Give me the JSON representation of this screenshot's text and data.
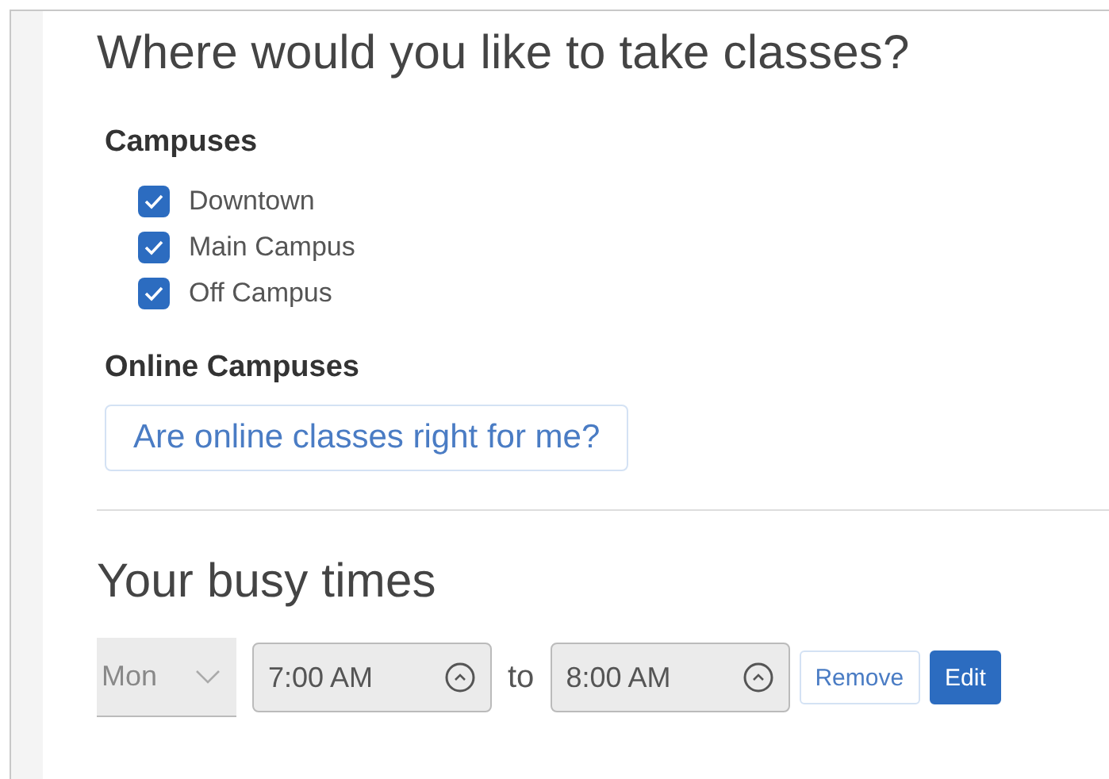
{
  "heading": "Where would you like to take classes?",
  "campuses": {
    "title": "Campuses",
    "items": [
      {
        "label": "Downtown",
        "checked": true
      },
      {
        "label": "Main Campus",
        "checked": true
      },
      {
        "label": "Off Campus",
        "checked": true
      }
    ]
  },
  "online": {
    "title": "Online Campuses",
    "link": "Are online classes right for me?"
  },
  "busy": {
    "title": "Your busy times",
    "rows": [
      {
        "day": "Mon",
        "start": "7:00 AM",
        "separator": "to",
        "end": "8:00 AM",
        "disabled": true,
        "buttons": [
          {
            "label": "Remove",
            "kind": "secondary"
          },
          {
            "label": "Edit",
            "kind": "primary"
          }
        ]
      }
    ]
  }
}
